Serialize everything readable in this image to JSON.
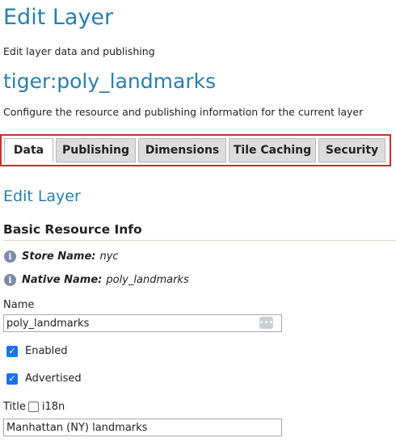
{
  "header": {
    "title": "Edit Layer",
    "description": "Edit layer data and publishing",
    "layer_name": "tiger:poly_landmarks",
    "layer_description": "Configure the resource and publishing information for the current layer"
  },
  "tabs": [
    {
      "label": "Data",
      "active": true
    },
    {
      "label": "Publishing",
      "active": false
    },
    {
      "label": "Dimensions",
      "active": false
    },
    {
      "label": "Tile Caching",
      "active": false
    },
    {
      "label": "Security",
      "active": false
    }
  ],
  "form": {
    "section_title": "Edit Layer",
    "subsection_title": "Basic Resource Info",
    "store": {
      "label": "Store Name:",
      "value": "nyc",
      "icon": "info-icon"
    },
    "native": {
      "label": "Native Name:",
      "value": "poly_landmarks",
      "icon": "info-icon"
    },
    "name_label": "Name",
    "name_value": "poly_landmarks",
    "name_button_glyph": "•••",
    "enabled": {
      "label": "Enabled",
      "checked": true
    },
    "advertised": {
      "label": "Advertised",
      "checked": true
    },
    "title_label": "Title",
    "i18n": {
      "label": "i18n",
      "checked": false
    },
    "title_value": "Manhattan (NY) landmarks"
  },
  "colors": {
    "accent": "#2a7fa8",
    "highlight_border": "#d42a2a",
    "checkbox": "#1a73e8"
  }
}
